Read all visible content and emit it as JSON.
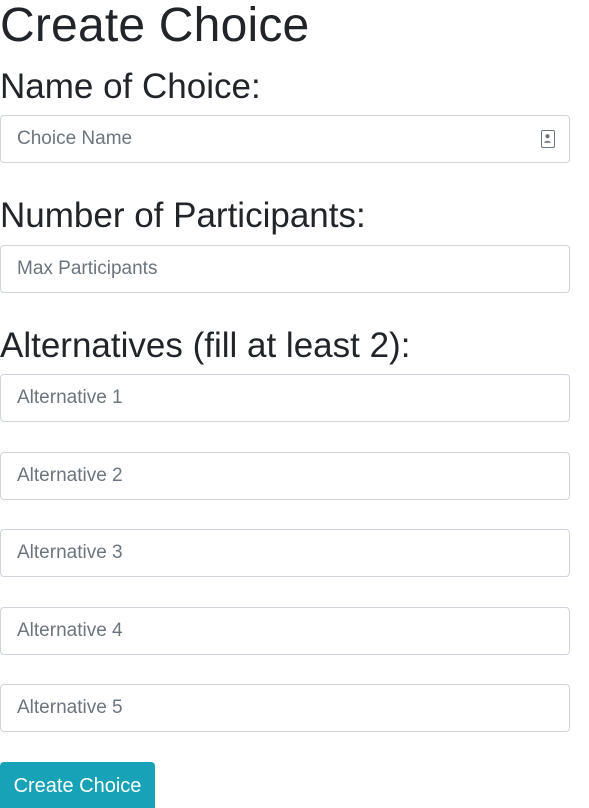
{
  "page": {
    "title": "Create Choice"
  },
  "form": {
    "name_label": "Name of Choice:",
    "name_placeholder": "Choice Name",
    "participants_label": "Number of Participants:",
    "participants_placeholder": "Max Participants",
    "alternatives_label": "Alternatives (fill at least 2):",
    "alternatives": [
      {
        "placeholder": "Alternative 1"
      },
      {
        "placeholder": "Alternative 2"
      },
      {
        "placeholder": "Alternative 3"
      },
      {
        "placeholder": "Alternative 4"
      },
      {
        "placeholder": "Alternative 5"
      }
    ],
    "submit_label": "Create Choice"
  },
  "icons": {
    "name_field_icon": "contact-card-icon"
  },
  "colors": {
    "primary_button": "#17a2b8",
    "input_border": "#ced4da",
    "placeholder_text": "#6c757d",
    "heading_text": "#212529"
  }
}
